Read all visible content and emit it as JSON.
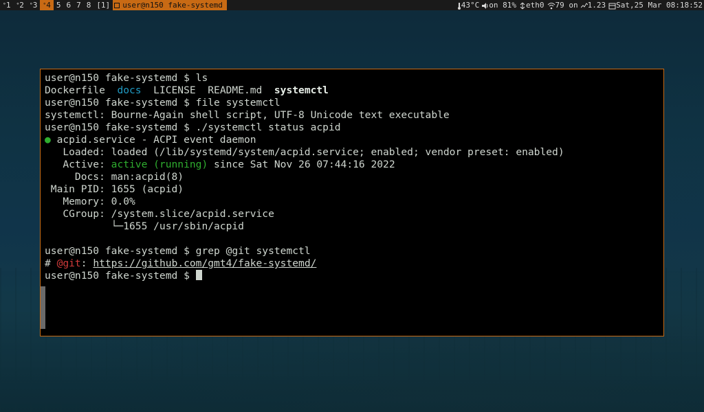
{
  "bar": {
    "workspaces": [
      {
        "label": "1",
        "badge": "°",
        "active": false
      },
      {
        "label": "2",
        "badge": "°",
        "active": false
      },
      {
        "label": "3",
        "badge": "°",
        "active": false
      },
      {
        "label": "4",
        "badge": "°",
        "active": true
      },
      {
        "label": "5",
        "badge": "",
        "active": false
      },
      {
        "label": "6",
        "badge": "",
        "active": false
      },
      {
        "label": "7",
        "badge": "",
        "active": false
      },
      {
        "label": "8",
        "badge": "",
        "active": false
      },
      {
        "label": "[1]",
        "badge": "",
        "active": false
      }
    ],
    "title": "user@n150 fake-systemd",
    "temp": "43°C",
    "volume": "on 81%",
    "net_if": "eth0",
    "wifi": "79 on",
    "load": "1.23",
    "clock": "Sat,25 Mar 08:18:52"
  },
  "terminal": {
    "prompt": "user@n150 fake-systemd $ ",
    "cmd_ls": "ls",
    "ls_out": {
      "a": "Dockerfile  ",
      "b": "docs",
      "c": "  LICENSE  README.md  ",
      "d": "systemctl"
    },
    "cmd_file": "file systemctl",
    "file_out": "systemctl: Bourne-Again shell script, UTF-8 Unicode text executable",
    "cmd_status": "./systemctl status acpid",
    "svc_head": " acpid.service - ACPI event daemon",
    "svc_loaded": "   Loaded: loaded (/lib/systemd/system/acpid.service; enabled; vendor preset: enabled)",
    "svc_active_lbl": "   Active: ",
    "svc_active_val": "active (running)",
    "svc_active_tail": " since Sat Nov 26 07:44:16 2022",
    "svc_docs": "     Docs: man:acpid(8)",
    "svc_pid": " Main PID: 1655 (acpid)",
    "svc_mem": "   Memory: 0.0%",
    "svc_cg1": "   CGroup: /system.slice/acpid.service",
    "svc_cg2": "           └─1655 /usr/sbin/acpid",
    "cmd_grep": "grep @git systemctl",
    "grep_hash": "# ",
    "grep_match": "@git",
    "grep_tail": ": ",
    "grep_url": "https://github.com/gmt4/fake-systemd/"
  }
}
